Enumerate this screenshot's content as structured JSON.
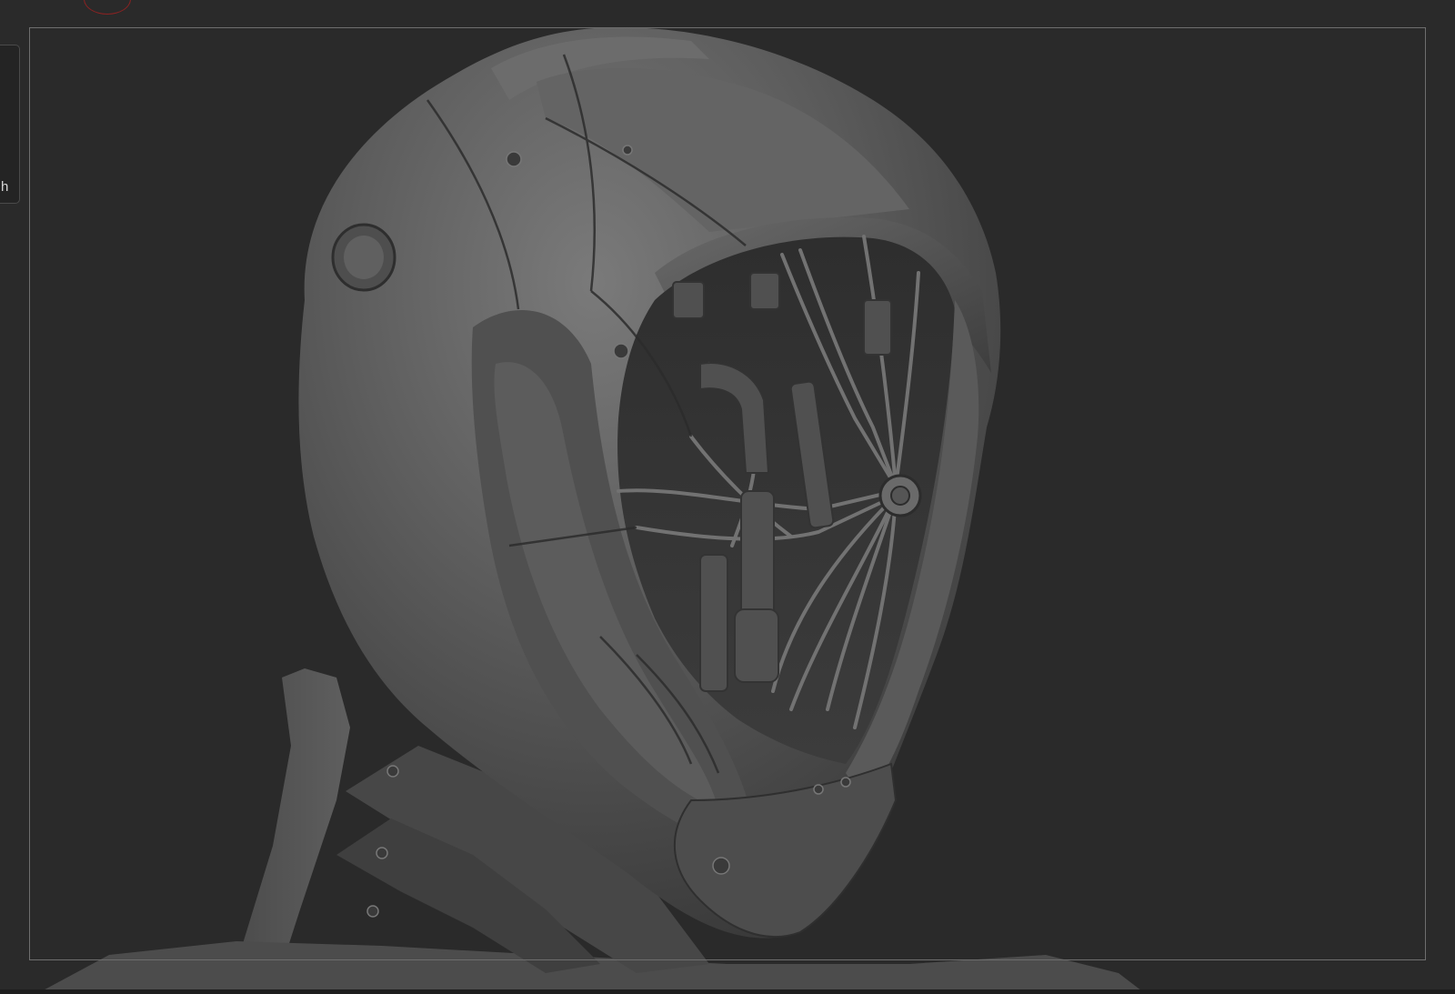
{
  "viewport": {
    "background_color": "#2a2a2a",
    "frame_color": "#6e6e6e",
    "model_base_color": "#5b5b5b",
    "model_shadow_color": "#242424",
    "model_highlight_color": "#8a8a8a"
  },
  "side_tab": {
    "label": "h"
  },
  "record_indicator": {
    "color": "#8a2222"
  }
}
